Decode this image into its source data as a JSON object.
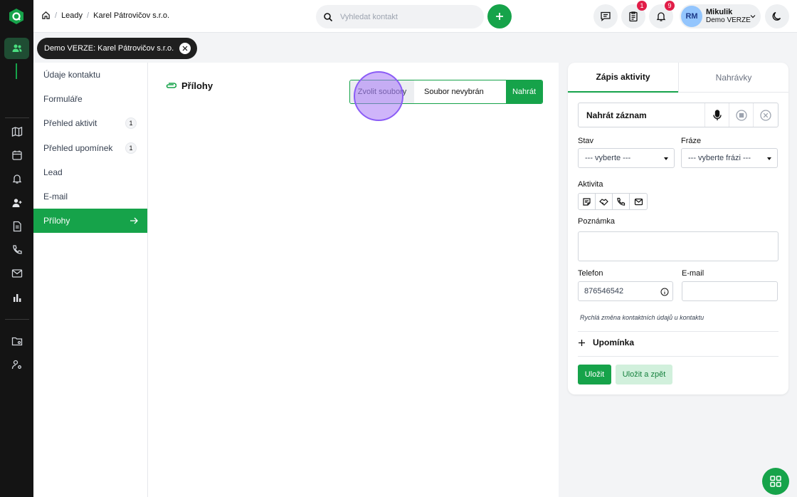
{
  "breadcrumb": {
    "level1": "Leady",
    "level2": "Karel Pátrovičov s.r.o."
  },
  "search": {
    "placeholder": "Vyhledat kontakt"
  },
  "header": {
    "tasks_badge": "1",
    "notifications_badge": "9"
  },
  "user": {
    "initials": "RM",
    "name": "Mikulik",
    "company": "Demo VERZE"
  },
  "contact_tab": {
    "label": "Demo VERZE: Karel Pátrovičov s.r.o."
  },
  "menu": {
    "items": [
      {
        "label": "Údaje kontaktu",
        "count": ""
      },
      {
        "label": "Formuláře",
        "count": ""
      },
      {
        "label": "Přehled aktivit",
        "count": "1"
      },
      {
        "label": "Přehled upomínek",
        "count": "1"
      },
      {
        "label": "Lead",
        "count": ""
      },
      {
        "label": "E-mail",
        "count": ""
      },
      {
        "label": "Přílohy",
        "count": ""
      }
    ],
    "active_index": 6
  },
  "attachments": {
    "title": "Přílohy",
    "choose_label": "Zvolit soubory",
    "no_file_label": "Soubor nevybrán",
    "upload_label": "Nahrát"
  },
  "activity_panel": {
    "tabs": [
      "Zápis aktivity",
      "Nahrávky"
    ],
    "record_label": "Nahrát záznam",
    "status_label": "Stav",
    "status_value": "--- vyberte ---",
    "phrase_label": "Fráze",
    "phrase_value": "--- vyberte frázi ---",
    "activity_label": "Aktivita",
    "note_label": "Poznámka",
    "phone_label": "Telefon",
    "phone_value": "876546542",
    "email_label": "E-mail",
    "email_value": "",
    "hint": "Rychlá změna kontaktních údajů u kontaktu",
    "reminder_label": "Upomínka",
    "save_label": "Uložit",
    "save_back_label": "Uložit a zpět"
  },
  "colors": {
    "accent": "#16a34a",
    "rail": "#141414",
    "badge": "#e11d48",
    "click_marker": "#a878f5"
  }
}
